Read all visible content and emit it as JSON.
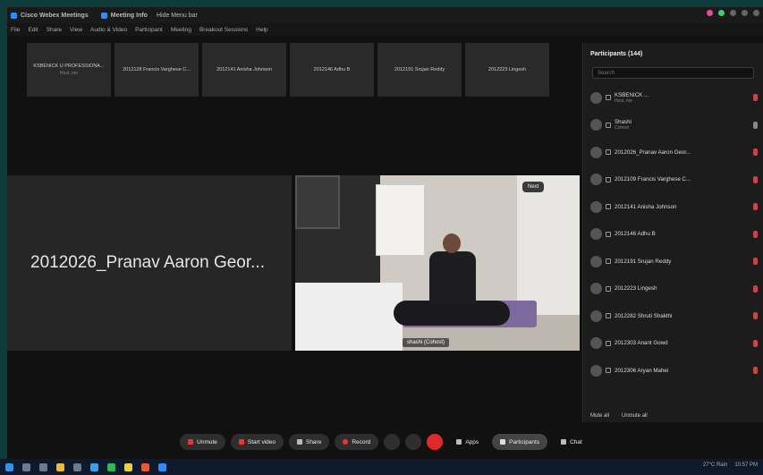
{
  "window": {
    "app_title": "Cisco Webex Meetings",
    "meeting_info": "Meeting Info",
    "hide_menu": "Hide Menu bar"
  },
  "menu": [
    "File",
    "Edit",
    "Share",
    "View",
    "Audio & Video",
    "Participant",
    "Meeting",
    "Breakout Sessions",
    "Help"
  ],
  "thumbnails": [
    {
      "label": "KSBENICK U PROFESSIONA...",
      "sub": "Host, me"
    },
    {
      "label": "2012128 Francis Varghese C..."
    },
    {
      "label": "2012141 Anisha Johnson"
    },
    {
      "label": "2012146 Adhu B"
    },
    {
      "label": "2012191 Srujan Reddy"
    },
    {
      "label": "2012223 Lingesh"
    }
  ],
  "left_tile_name": "2012026_Pranav Aaron Geor...",
  "video_tile": {
    "name_tag": "shashi (Cohost)",
    "button": "Next"
  },
  "panel": {
    "title": "Participants (144)",
    "search_placeholder": "Search",
    "items": [
      {
        "name": "KSBENICK ...",
        "sub": "Host, me"
      },
      {
        "name": "Shashi",
        "sub": "Cohost"
      },
      {
        "name": "2012026_Pranav Aaron Geor...",
        "sub": ""
      },
      {
        "name": "2012109 Francis Varghese C...",
        "sub": ""
      },
      {
        "name": "2012141 Anisha Johnson",
        "sub": ""
      },
      {
        "name": "2012146 Adhu B",
        "sub": ""
      },
      {
        "name": "2012191 Srujan Reddy",
        "sub": ""
      },
      {
        "name": "2012223 Lingesh",
        "sub": ""
      },
      {
        "name": "2012282 Shruti Shakthi",
        "sub": ""
      },
      {
        "name": "2012303 Anant Gowd",
        "sub": ""
      },
      {
        "name": "2012306 Aryan Mahei",
        "sub": ""
      }
    ],
    "mute_all": "Mute all",
    "unmute_all": "Unmute all"
  },
  "toolbar": {
    "unmute": "Unmute",
    "start_video": "Start video",
    "share": "Share",
    "record": "Record",
    "apps": "Apps",
    "participants": "Participants",
    "chat": "Chat"
  },
  "tray": {
    "weather": "27°C Rain",
    "time": "10:57 PM"
  }
}
